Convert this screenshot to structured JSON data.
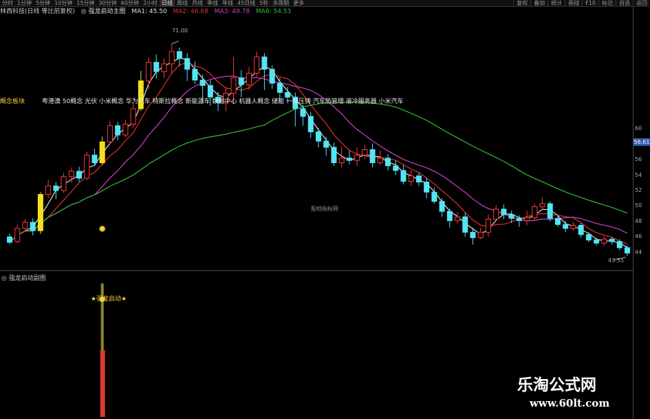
{
  "toolbar": {
    "tabs": [
      "分时",
      "1分钟",
      "5分钟",
      "10分钟",
      "15分钟",
      "30分钟",
      "60分钟",
      "2小时",
      "日线",
      "周线",
      "月线",
      "季线",
      "年线",
      "45日线",
      "5秒",
      "多周期",
      "更多"
    ],
    "active_tab": "日线",
    "right_buttons": [
      "复权",
      "叠加",
      "统计",
      "画线",
      "F10",
      "标记",
      "自选",
      "返回"
    ]
  },
  "infobar": {
    "stock": "林西科技(日线 等比前复权)",
    "indicator": "◎ 强龙启动主图",
    "ma1": "MA1: 45.50",
    "ma2": "MA2: 46.68",
    "ma3": "MA3: 49.78",
    "ma4": "MA6: 54.53",
    "colors": {
      "ma1": "#e0e0e0",
      "ma2": "#e03030",
      "ma3": "#d040d0",
      "ma4": "#30c030"
    }
  },
  "concept": {
    "label": "概念板块",
    "text": "粤港澳 50概念 光伏 小米概念 华为汽车 特斯拉概念 新能源车 数据中心 机器人概念 储能 一体压铸 汽车热管理 液冷服务器 小米汽车"
  },
  "price_axis": {
    "labels": [
      "60",
      "58",
      "56",
      "54",
      "52",
      "50",
      "48",
      "46",
      "44"
    ],
    "current": "56.61"
  },
  "annotations": {
    "max": "71.00",
    "min": "43.55",
    "center": "股档指标网"
  },
  "sub_panel": {
    "title": "◎ 强龙启动副图",
    "signal": "★强龙启动★"
  },
  "watermark": {
    "cn": "乐淘公式网",
    "url": "www.60lt.com"
  },
  "chart_data": {
    "type": "candlestick",
    "candles": [
      [
        46.0,
        45.3,
        46.4,
        45.1
      ],
      [
        45.4,
        47.1,
        47.6,
        45.2
      ],
      [
        47.1,
        47.9,
        48.3,
        46.6
      ],
      [
        47.9,
        46.8,
        48.4,
        46.2
      ],
      [
        46.8,
        51.5,
        51.8,
        46.4
      ],
      [
        51.5,
        52.6,
        53.4,
        51.0
      ],
      [
        52.6,
        52.0,
        53.1,
        50.9
      ],
      [
        52.0,
        53.8,
        54.3,
        51.7
      ],
      [
        53.8,
        54.5,
        55.0,
        53.0
      ],
      [
        54.5,
        53.6,
        55.1,
        53.1
      ],
      [
        53.6,
        56.6,
        57.0,
        53.3
      ],
      [
        56.6,
        55.6,
        57.4,
        55.2
      ],
      [
        55.6,
        58.3,
        59.0,
        55.3
      ],
      [
        58.3,
        60.4,
        61.0,
        58.0
      ],
      [
        60.4,
        59.2,
        60.9,
        58.5
      ],
      [
        59.2,
        60.6,
        61.2,
        58.8
      ],
      [
        60.6,
        62.6,
        63.3,
        60.1
      ],
      [
        62.6,
        66.2,
        67.5,
        62.3
      ],
      [
        66.2,
        68.6,
        69.2,
        65.1
      ],
      [
        68.6,
        67.4,
        69.6,
        66.5
      ],
      [
        67.4,
        68.4,
        69.1,
        66.6
      ],
      [
        68.4,
        70.0,
        71.0,
        67.2
      ],
      [
        70.0,
        69.1,
        70.5,
        68.1
      ],
      [
        69.1,
        67.7,
        69.8,
        66.2
      ],
      [
        67.7,
        66.3,
        68.7,
        65.8
      ],
      [
        66.3,
        65.6,
        67.0,
        63.3
      ],
      [
        65.6,
        64.1,
        66.3,
        63.0
      ],
      [
        64.1,
        63.4,
        64.8,
        62.3
      ],
      [
        63.4,
        64.6,
        65.4,
        62.3
      ],
      [
        64.6,
        66.6,
        69.3,
        63.3
      ],
      [
        66.6,
        65.7,
        67.6,
        64.1
      ],
      [
        65.7,
        67.2,
        68.0,
        65.1
      ],
      [
        67.2,
        69.3,
        70.0,
        66.7
      ],
      [
        69.3,
        67.7,
        69.8,
        65.0
      ],
      [
        67.7,
        65.9,
        68.2,
        65.2
      ],
      [
        65.9,
        64.7,
        66.6,
        63.6
      ],
      [
        64.7,
        64.1,
        65.4,
        63.3
      ],
      [
        64.1,
        62.6,
        64.7,
        60.3
      ],
      [
        62.6,
        61.6,
        63.1,
        60.4
      ],
      [
        61.6,
        59.6,
        62.2,
        58.8
      ],
      [
        59.6,
        58.4,
        60.1,
        57.6
      ],
      [
        58.4,
        57.6,
        59.0,
        56.5
      ],
      [
        57.6,
        55.6,
        58.2,
        55.2
      ],
      [
        55.6,
        56.2,
        57.7,
        55.0
      ],
      [
        56.2,
        55.9,
        57.2,
        55.4
      ],
      [
        55.9,
        56.6,
        57.6,
        55.2
      ],
      [
        56.6,
        57.3,
        57.9,
        56.1
      ],
      [
        57.3,
        55.6,
        58.1,
        55.0
      ],
      [
        55.6,
        56.2,
        57.2,
        55.3
      ],
      [
        56.2,
        55.2,
        56.7,
        54.6
      ],
      [
        55.2,
        54.6,
        55.9,
        54.0
      ],
      [
        54.6,
        53.2,
        55.3,
        52.8
      ],
      [
        53.2,
        53.9,
        54.6,
        52.6
      ],
      [
        53.9,
        53.1,
        54.3,
        52.6
      ],
      [
        53.1,
        51.8,
        53.6,
        51.0
      ],
      [
        51.8,
        50.6,
        52.4,
        50.3
      ],
      [
        50.6,
        49.3,
        51.0,
        48.6
      ],
      [
        49.3,
        48.1,
        49.7,
        47.2
      ],
      [
        48.1,
        48.6,
        49.2,
        47.7
      ],
      [
        48.6,
        46.6,
        49.1,
        46.0
      ],
      [
        46.6,
        45.9,
        47.2,
        45.0
      ],
      [
        45.9,
        46.6,
        47.2,
        45.7
      ],
      [
        46.6,
        48.3,
        48.9,
        46.0
      ],
      [
        48.3,
        49.6,
        50.1,
        48.0
      ],
      [
        49.6,
        48.9,
        50.2,
        48.3
      ],
      [
        48.9,
        48.4,
        49.4,
        47.8
      ],
      [
        48.4,
        48.1,
        48.8,
        47.3
      ],
      [
        48.1,
        48.5,
        49.4,
        47.5
      ],
      [
        48.5,
        49.9,
        50.3,
        48.1
      ],
      [
        49.9,
        50.3,
        51.1,
        49.5
      ],
      [
        50.3,
        48.4,
        50.6,
        48.0
      ],
      [
        48.4,
        47.6,
        48.9,
        47.3
      ],
      [
        47.6,
        47.1,
        48.1,
        46.6
      ],
      [
        47.1,
        47.5,
        47.9,
        46.8
      ],
      [
        47.5,
        46.3,
        47.8,
        45.9
      ],
      [
        46.3,
        45.6,
        46.6,
        45.3
      ],
      [
        45.6,
        45.2,
        45.9,
        44.9
      ],
      [
        45.2,
        45.7,
        46.1,
        44.8
      ],
      [
        45.7,
        45.4,
        46.0,
        45.0
      ],
      [
        45.4,
        44.6,
        45.7,
        44.3
      ],
      [
        44.6,
        43.9,
        44.9,
        43.55
      ]
    ],
    "highlight_indices": [
      4,
      12,
      17
    ],
    "y_range": [
      43,
      74
    ]
  }
}
